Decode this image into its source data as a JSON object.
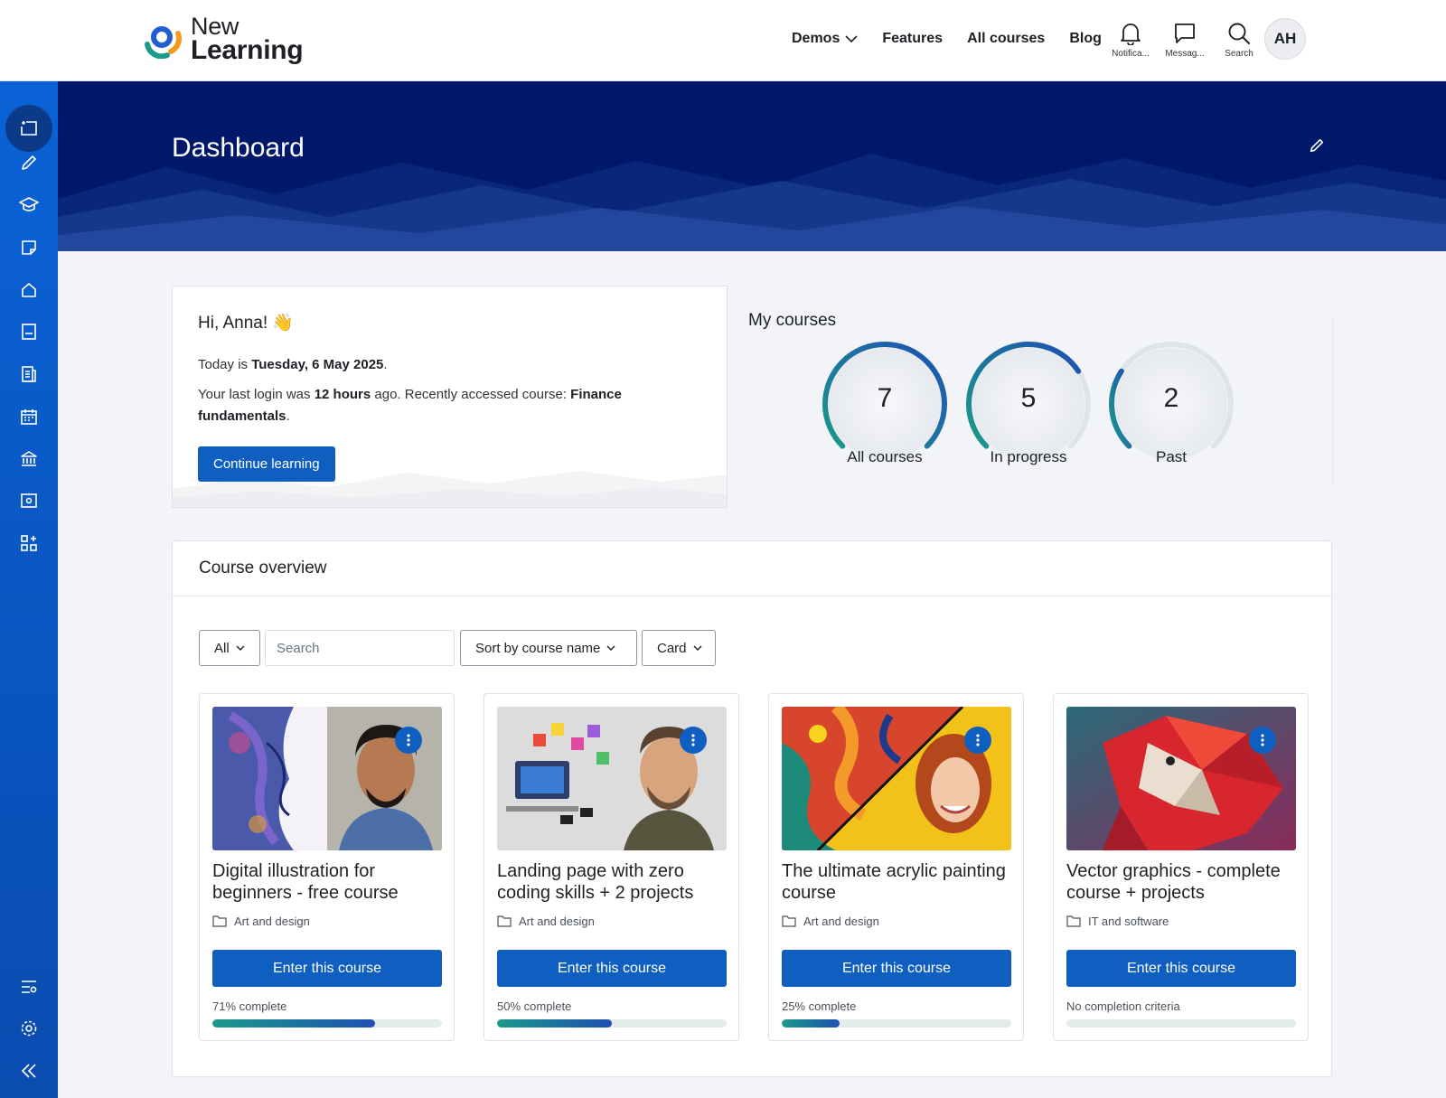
{
  "brand": {
    "line1": "New",
    "line2": "Learning"
  },
  "nav": {
    "items": [
      "Demos",
      "Features",
      "All courses",
      "Blog"
    ],
    "icons": [
      {
        "label": "Notifica...",
        "icon": "bell-icon"
      },
      {
        "label": "Messag...",
        "icon": "message-icon"
      },
      {
        "label": "Search",
        "icon": "search-icon"
      }
    ],
    "avatar": "AH"
  },
  "sidebar": {
    "items": [
      "dashboard-icon",
      "pencil-icon",
      "graduation-cap-icon",
      "note-icon",
      "home-icon",
      "book-icon",
      "report-icon",
      "calendar-icon",
      "institution-icon",
      "folder-gear-icon",
      "apps-add-icon"
    ],
    "bottom": [
      "filter-settings-icon",
      "gear-icon",
      "collapse-icon"
    ]
  },
  "header": {
    "title": "Dashboard"
  },
  "greeting": {
    "hello": "Hi, Anna! 👋",
    "today_prefix": "Today is ",
    "today_date": "Tuesday, 6 May 2025",
    "today_suffix": ".",
    "login_prefix": "Your last login was ",
    "login_time": "12 hours",
    "login_mid": " ago. Recently accessed course: ",
    "login_course": "Finance fundamentals",
    "login_suffix": ".",
    "button": "Continue learning"
  },
  "my_courses": {
    "title": "My courses",
    "stats": [
      {
        "value": "7",
        "label": "All courses",
        "fraction": 1.0
      },
      {
        "value": "5",
        "label": "In progress",
        "fraction": 0.71
      },
      {
        "value": "2",
        "label": "Past",
        "fraction": 0.29
      }
    ]
  },
  "overview": {
    "title": "Course overview",
    "filter_all": "All",
    "search_placeholder": "Search",
    "sort_label": "Sort by course name",
    "view_label": "Card",
    "enter_label": "Enter this course",
    "courses": [
      {
        "title": "Digital illustration for beginners - free course",
        "category": "Art and design",
        "progress_label": "71% complete",
        "progress": 0.71
      },
      {
        "title": "Landing page with zero coding skills + 2 projects",
        "category": "Art and design",
        "progress_label": "50% complete",
        "progress": 0.5
      },
      {
        "title": "The ultimate acrylic painting course",
        "category": "Art and design",
        "progress_label": "25% complete",
        "progress": 0.25
      },
      {
        "title": "Vector graphics - complete course + projects",
        "category": "IT and software",
        "progress_label": "No completion criteria",
        "progress": 0
      }
    ]
  },
  "colors": {
    "primary": "#0f5fc0",
    "banner": "#00186a",
    "sidebar": "#0a62d6",
    "progress_start": "#1b9a8a",
    "progress_end": "#1f4fb3"
  }
}
